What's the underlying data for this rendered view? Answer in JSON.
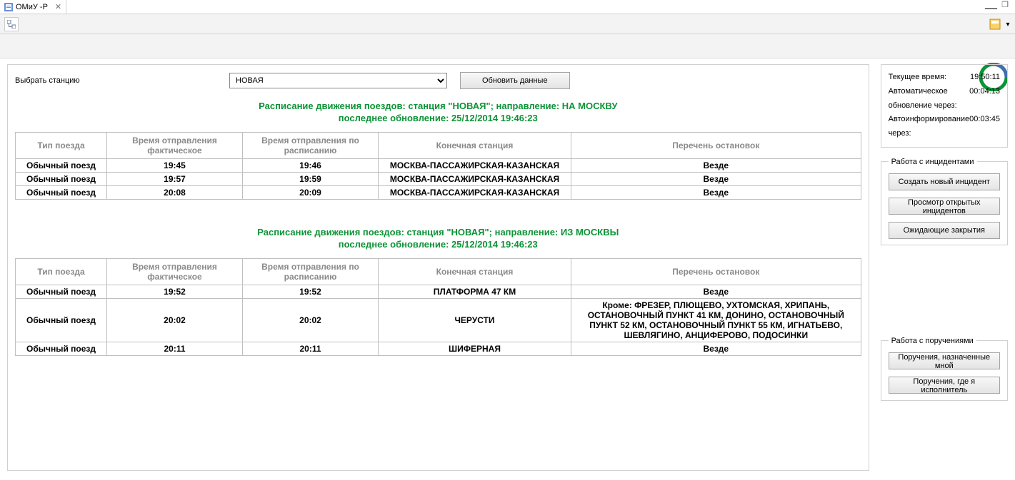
{
  "tab": {
    "title": "ОМиУ -Р"
  },
  "filter": {
    "label": "Выбрать станцию",
    "station": "НОВАЯ",
    "refresh": "Обновить данные"
  },
  "schedules": [
    {
      "title_l1": "Расписание движения поездов: станция \"НОВАЯ\"; направление: НА МОСКВУ",
      "title_l2": "последнее обновление: 25/12/2014 19:46:23",
      "rows": [
        {
          "type": "Обычный поезд",
          "fact": "19:45",
          "plan": "19:46",
          "dest": "МОСКВА-ПАССАЖИРСКАЯ-КАЗАНСКАЯ",
          "stops": "Везде"
        },
        {
          "type": "Обычный поезд",
          "fact": "19:57",
          "plan": "19:59",
          "dest": "МОСКВА-ПАССАЖИРСКАЯ-КАЗАНСКАЯ",
          "stops": "Везде"
        },
        {
          "type": "Обычный поезд",
          "fact": "20:08",
          "plan": "20:09",
          "dest": "МОСКВА-ПАССАЖИРСКАЯ-КАЗАНСКАЯ",
          "stops": "Везде"
        }
      ]
    },
    {
      "title_l1": "Расписание движения поездов: станция \"НОВАЯ\"; направление: ИЗ МОСКВЫ",
      "title_l2": "последнее обновление: 25/12/2014 19:46:23",
      "rows": [
        {
          "type": "Обычный поезд",
          "fact": "19:52",
          "plan": "19:52",
          "dest": "ПЛАТФОРМА 47 КМ",
          "stops": "Везде"
        },
        {
          "type": "Обычный поезд",
          "fact": "20:02",
          "plan": "20:02",
          "dest": "ЧЕРУСТИ",
          "stops": "Кроме: ФРЕЗЕР, ПЛЮЩЕВО, УХТОМСКАЯ, ХРИПАНЬ, ОСТАНОВОЧНЫЙ ПУНКТ 41 КМ, ДОНИНО, ОСТАНОВОЧНЫЙ ПУНКТ 52 КМ, ОСТАНОВОЧНЫЙ ПУНКТ 55 КМ, ИГНАТЬЕВО, ШЕВЛЯГИНО, АНЦИФЕРОВО, ПОДОСИНКИ"
        },
        {
          "type": "Обычный поезд",
          "fact": "20:11",
          "plan": "20:11",
          "dest": "ШИФЕРНАЯ",
          "stops": "Везде"
        }
      ]
    }
  ],
  "columns": {
    "type": "Тип поезда",
    "fact": "Время отправления фактическое",
    "plan": "Время отправления по расписанию",
    "dest": "Конечная станция",
    "stops": "Перечень остановок"
  },
  "status": {
    "time_label": "Текущее время:",
    "time_value": "19:50:11",
    "auto_label": "Автоматическое обновление через:",
    "auto_value": "00:04:13",
    "inform_label": "Автоинформирование через:",
    "inform_value": "00:03:45"
  },
  "incidents": {
    "legend": "Работа с инцидентами",
    "create": "Создать новый инцидент",
    "view": "Просмотр открытых инцидентов",
    "pending": "Ожидающие закрытия"
  },
  "tasks": {
    "legend": "Работа с поручениями",
    "mine": "Поручения, назначенные мной",
    "assigned": "Поручения, где я исполнитель"
  }
}
